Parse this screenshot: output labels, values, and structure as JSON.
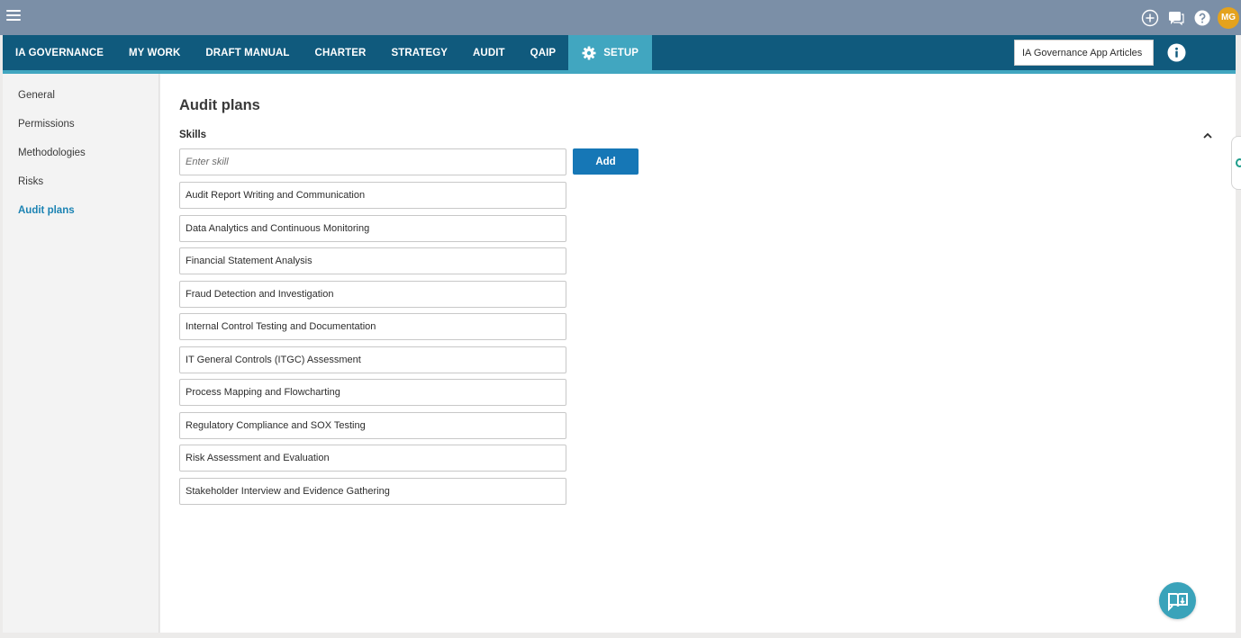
{
  "topbar": {
    "icons": [
      "hamburger-menu-icon",
      "plus-circle-icon",
      "chat-icon",
      "help-icon"
    ],
    "avatar_initials": "MG"
  },
  "nav": {
    "tabs": [
      {
        "label": "IA GOVERNANCE"
      },
      {
        "label": "MY WORK"
      },
      {
        "label": "DRAFT MANUAL"
      },
      {
        "label": "CHARTER"
      },
      {
        "label": "STRATEGY"
      },
      {
        "label": "AUDIT"
      },
      {
        "label": "QAIP"
      },
      {
        "label": "SETUP",
        "active": true,
        "icon": "gear-icon"
      }
    ],
    "search_value": "IA Governance App Articles",
    "info_icon": "info-icon"
  },
  "sidebar": {
    "items": [
      {
        "label": "General"
      },
      {
        "label": "Permissions"
      },
      {
        "label": "Methodologies"
      },
      {
        "label": "Risks"
      },
      {
        "label": "Audit plans",
        "active": true
      }
    ]
  },
  "main": {
    "title": "Audit plans",
    "section_label": "Skills",
    "input_placeholder": "Enter skill",
    "add_label": "Add",
    "skills": [
      "Audit Report Writing and Communication",
      "Data Analytics and Continuous Monitoring",
      "Financial Statement Analysis",
      "Fraud Detection and Investigation",
      "Internal Control Testing and Documentation",
      "IT General Controls (ITGC) Assessment",
      "Process Mapping and Flowcharting",
      "Regulatory Compliance and SOX Testing",
      "Risk Assessment and Evaluation",
      "Stakeholder Interview and Evidence Gathering"
    ]
  },
  "colors": {
    "topbar": "#7b8fa7",
    "navbar": "#105a7d",
    "accent": "#41a6c0",
    "primary_button": "#1677b6",
    "active_link": "#1b83b3",
    "avatar": "#e4a21d"
  }
}
